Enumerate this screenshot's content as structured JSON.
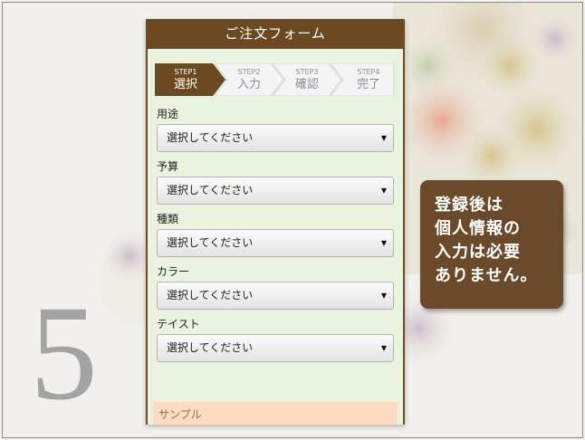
{
  "header": {
    "title": "ご注文フォーム"
  },
  "steps": [
    {
      "num": "STEP1",
      "label": "選択",
      "active": true
    },
    {
      "num": "STEP2",
      "label": "入力",
      "active": false
    },
    {
      "num": "STEP3",
      "label": "確認",
      "active": false
    },
    {
      "num": "STEP4",
      "label": "完了",
      "active": false
    }
  ],
  "fields": [
    {
      "label": "用途",
      "value": "選択してください"
    },
    {
      "label": "予算",
      "value": "選択してください"
    },
    {
      "label": "種類",
      "value": "選択してください"
    },
    {
      "label": "カラー",
      "value": "選択してください"
    },
    {
      "label": "テイスト",
      "value": "選択してください"
    }
  ],
  "sample": {
    "label": "サンプル"
  },
  "slide_number": "5",
  "callout": {
    "lines": [
      "登録後は",
      "個人情報の",
      "入力は必要",
      "ありません。"
    ]
  },
  "colors": {
    "header": "#6b4a22",
    "step_active": "#6b4a22",
    "callout": "#6a4a2a",
    "form_bg": "#e9f3df"
  },
  "icons": {
    "select_caret": "caret-down-icon"
  }
}
